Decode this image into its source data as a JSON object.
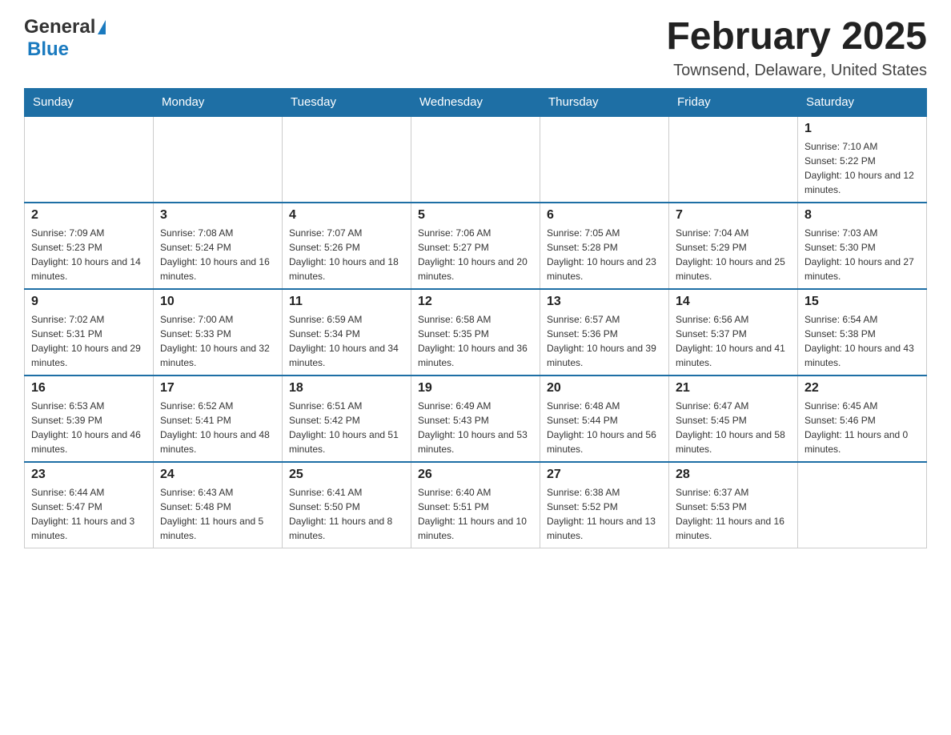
{
  "header": {
    "logo_general": "General",
    "logo_blue": "Blue",
    "title": "February 2025",
    "location": "Townsend, Delaware, United States"
  },
  "days_of_week": [
    "Sunday",
    "Monday",
    "Tuesday",
    "Wednesday",
    "Thursday",
    "Friday",
    "Saturday"
  ],
  "weeks": [
    [
      {
        "day": "",
        "info": ""
      },
      {
        "day": "",
        "info": ""
      },
      {
        "day": "",
        "info": ""
      },
      {
        "day": "",
        "info": ""
      },
      {
        "day": "",
        "info": ""
      },
      {
        "day": "",
        "info": ""
      },
      {
        "day": "1",
        "info": "Sunrise: 7:10 AM\nSunset: 5:22 PM\nDaylight: 10 hours and 12 minutes."
      }
    ],
    [
      {
        "day": "2",
        "info": "Sunrise: 7:09 AM\nSunset: 5:23 PM\nDaylight: 10 hours and 14 minutes."
      },
      {
        "day": "3",
        "info": "Sunrise: 7:08 AM\nSunset: 5:24 PM\nDaylight: 10 hours and 16 minutes."
      },
      {
        "day": "4",
        "info": "Sunrise: 7:07 AM\nSunset: 5:26 PM\nDaylight: 10 hours and 18 minutes."
      },
      {
        "day": "5",
        "info": "Sunrise: 7:06 AM\nSunset: 5:27 PM\nDaylight: 10 hours and 20 minutes."
      },
      {
        "day": "6",
        "info": "Sunrise: 7:05 AM\nSunset: 5:28 PM\nDaylight: 10 hours and 23 minutes."
      },
      {
        "day": "7",
        "info": "Sunrise: 7:04 AM\nSunset: 5:29 PM\nDaylight: 10 hours and 25 minutes."
      },
      {
        "day": "8",
        "info": "Sunrise: 7:03 AM\nSunset: 5:30 PM\nDaylight: 10 hours and 27 minutes."
      }
    ],
    [
      {
        "day": "9",
        "info": "Sunrise: 7:02 AM\nSunset: 5:31 PM\nDaylight: 10 hours and 29 minutes."
      },
      {
        "day": "10",
        "info": "Sunrise: 7:00 AM\nSunset: 5:33 PM\nDaylight: 10 hours and 32 minutes."
      },
      {
        "day": "11",
        "info": "Sunrise: 6:59 AM\nSunset: 5:34 PM\nDaylight: 10 hours and 34 minutes."
      },
      {
        "day": "12",
        "info": "Sunrise: 6:58 AM\nSunset: 5:35 PM\nDaylight: 10 hours and 36 minutes."
      },
      {
        "day": "13",
        "info": "Sunrise: 6:57 AM\nSunset: 5:36 PM\nDaylight: 10 hours and 39 minutes."
      },
      {
        "day": "14",
        "info": "Sunrise: 6:56 AM\nSunset: 5:37 PM\nDaylight: 10 hours and 41 minutes."
      },
      {
        "day": "15",
        "info": "Sunrise: 6:54 AM\nSunset: 5:38 PM\nDaylight: 10 hours and 43 minutes."
      }
    ],
    [
      {
        "day": "16",
        "info": "Sunrise: 6:53 AM\nSunset: 5:39 PM\nDaylight: 10 hours and 46 minutes."
      },
      {
        "day": "17",
        "info": "Sunrise: 6:52 AM\nSunset: 5:41 PM\nDaylight: 10 hours and 48 minutes."
      },
      {
        "day": "18",
        "info": "Sunrise: 6:51 AM\nSunset: 5:42 PM\nDaylight: 10 hours and 51 minutes."
      },
      {
        "day": "19",
        "info": "Sunrise: 6:49 AM\nSunset: 5:43 PM\nDaylight: 10 hours and 53 minutes."
      },
      {
        "day": "20",
        "info": "Sunrise: 6:48 AM\nSunset: 5:44 PM\nDaylight: 10 hours and 56 minutes."
      },
      {
        "day": "21",
        "info": "Sunrise: 6:47 AM\nSunset: 5:45 PM\nDaylight: 10 hours and 58 minutes."
      },
      {
        "day": "22",
        "info": "Sunrise: 6:45 AM\nSunset: 5:46 PM\nDaylight: 11 hours and 0 minutes."
      }
    ],
    [
      {
        "day": "23",
        "info": "Sunrise: 6:44 AM\nSunset: 5:47 PM\nDaylight: 11 hours and 3 minutes."
      },
      {
        "day": "24",
        "info": "Sunrise: 6:43 AM\nSunset: 5:48 PM\nDaylight: 11 hours and 5 minutes."
      },
      {
        "day": "25",
        "info": "Sunrise: 6:41 AM\nSunset: 5:50 PM\nDaylight: 11 hours and 8 minutes."
      },
      {
        "day": "26",
        "info": "Sunrise: 6:40 AM\nSunset: 5:51 PM\nDaylight: 11 hours and 10 minutes."
      },
      {
        "day": "27",
        "info": "Sunrise: 6:38 AM\nSunset: 5:52 PM\nDaylight: 11 hours and 13 minutes."
      },
      {
        "day": "28",
        "info": "Sunrise: 6:37 AM\nSunset: 5:53 PM\nDaylight: 11 hours and 16 minutes."
      },
      {
        "day": "",
        "info": ""
      }
    ]
  ]
}
